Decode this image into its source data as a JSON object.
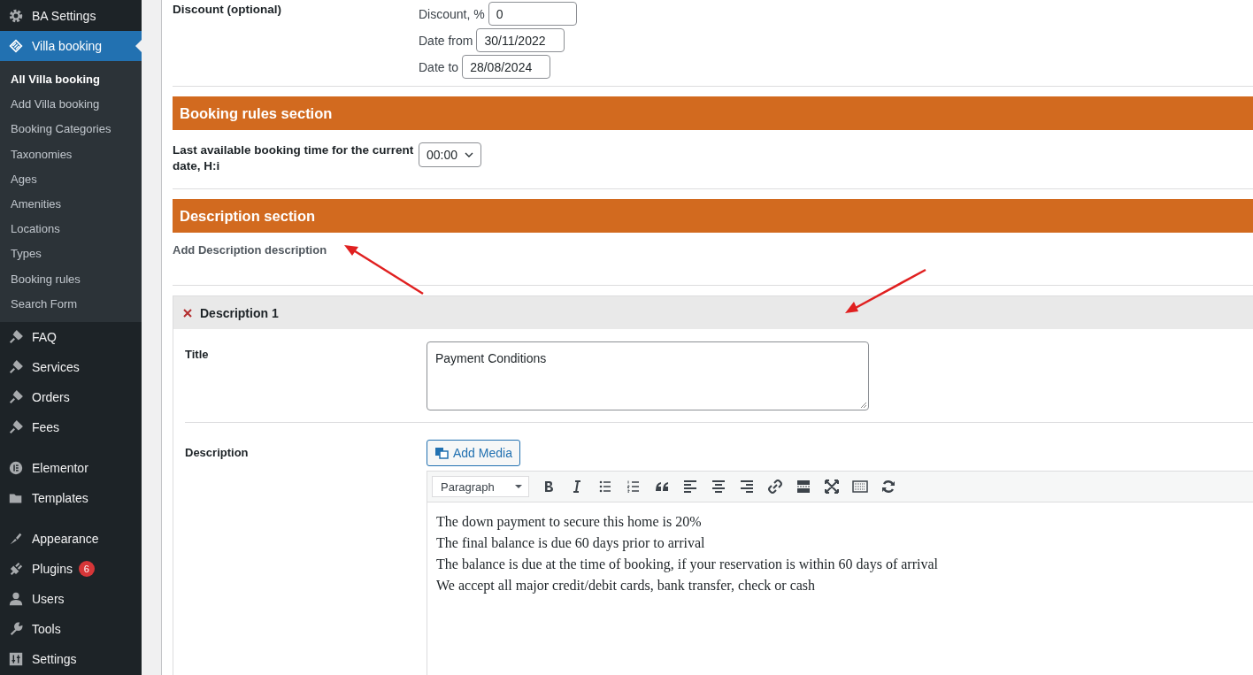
{
  "sidebar": {
    "groups": [
      [
        {
          "label": "BA Settings",
          "selected": false
        },
        {
          "label": "Villa booking",
          "selected": true,
          "children": [
            {
              "label": "All Villa booking",
              "selected": true
            },
            {
              "label": "Add Villa booking",
              "selected": false
            },
            {
              "label": "Booking Categories",
              "selected": false
            },
            {
              "label": "Taxonomies",
              "selected": false
            },
            {
              "label": "Ages",
              "selected": false
            },
            {
              "label": "Amenities",
              "selected": false
            },
            {
              "label": "Locations",
              "selected": false
            },
            {
              "label": "Types",
              "selected": false
            },
            {
              "label": "Booking rules",
              "selected": false
            },
            {
              "label": "Search Form",
              "selected": false
            }
          ]
        },
        {
          "label": "FAQ",
          "selected": false
        },
        {
          "label": "Services",
          "selected": false
        },
        {
          "label": "Orders",
          "selected": false
        },
        {
          "label": "Fees",
          "selected": false
        }
      ],
      [
        {
          "label": "Elementor",
          "selected": false
        },
        {
          "label": "Templates",
          "selected": false
        }
      ],
      [
        {
          "label": "Appearance",
          "selected": false
        },
        {
          "label": "Plugins",
          "selected": false,
          "badge": "6"
        },
        {
          "label": "Users",
          "selected": false
        },
        {
          "label": "Tools",
          "selected": false
        },
        {
          "label": "Settings",
          "selected": false
        }
      ]
    ]
  },
  "discount": {
    "label": "Discount (optional)",
    "fields": [
      {
        "label": "Discount, %",
        "value": "0"
      },
      {
        "label": "Date from",
        "value": "30/11/2022"
      },
      {
        "label": "Date to",
        "value": "28/08/2024"
      }
    ]
  },
  "booking_rules": {
    "heading": "Booking rules section",
    "field_label": "Last available booking time for the current date, H:i",
    "select_value": "00:00"
  },
  "description_section": {
    "heading": "Description section",
    "hint": "Add Description description",
    "item": {
      "title": "Description 1",
      "title_label": "Title",
      "title_value": "Payment Conditions",
      "description_label": "Description",
      "add_media": "Add Media",
      "format": "Paragraph",
      "lines": [
        "The down payment to secure this home is 20%",
        "The final balance is due 60 days prior to arrival",
        "The balance is due at the time of booking, if your reservation is within 60 days of arrival",
        "We accept all major credit/debit cards, bank transfer, check or cash"
      ]
    }
  }
}
